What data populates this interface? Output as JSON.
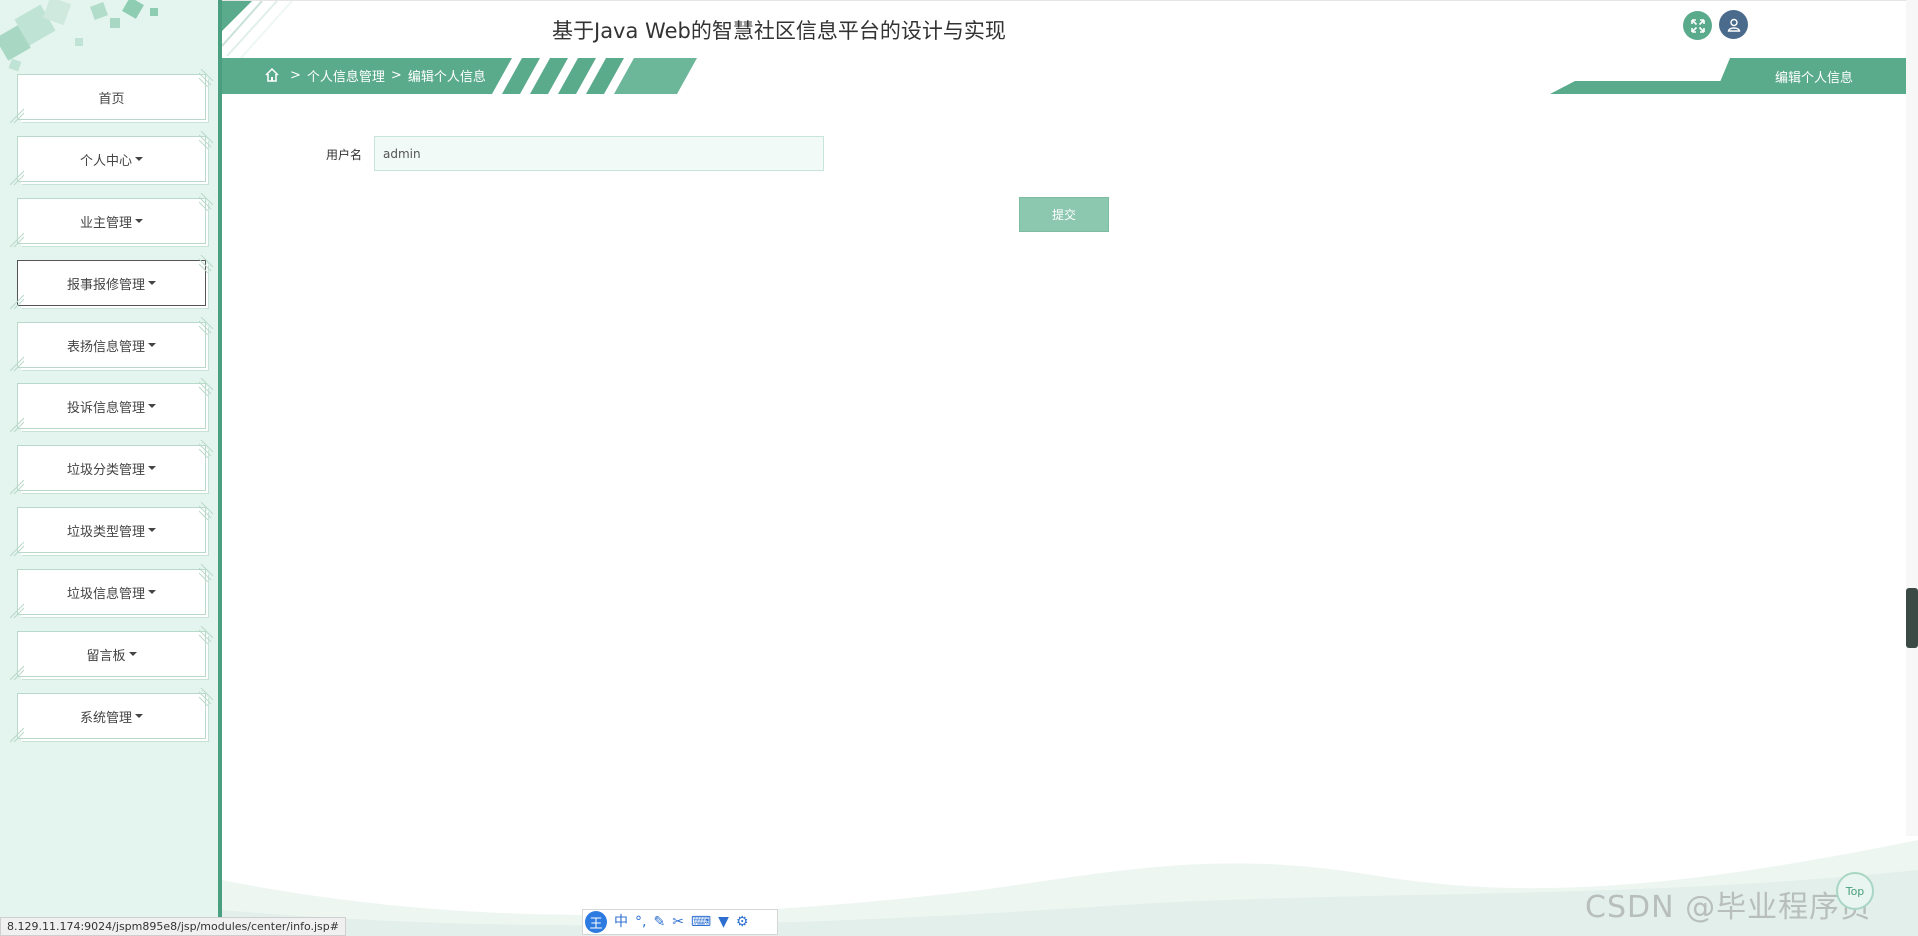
{
  "app": {
    "title": "基于Java Web的智慧社区信息平台的设计与实现"
  },
  "sidebar": {
    "items": [
      {
        "label": "首页",
        "caret": false
      },
      {
        "label": "个人中心",
        "caret": true
      },
      {
        "label": "业主管理",
        "caret": true
      },
      {
        "label": "报事报修管理",
        "caret": true
      },
      {
        "label": "表扬信息管理",
        "caret": true
      },
      {
        "label": "投诉信息管理",
        "caret": true
      },
      {
        "label": "垃圾分类管理",
        "caret": true
      },
      {
        "label": "垃圾类型管理",
        "caret": true
      },
      {
        "label": "垃圾信息管理",
        "caret": true
      },
      {
        "label": "留言板",
        "caret": true
      },
      {
        "label": "系统管理",
        "caret": true
      }
    ]
  },
  "header": {
    "fullscreen_icon": "expand-icon",
    "user_icon": "user-icon"
  },
  "breadcrumb": {
    "home_icon": "home-icon",
    "separator": ">",
    "level1": "个人信息管理",
    "level2": "编辑个人信息"
  },
  "page_tag": "编辑个人信息",
  "form": {
    "username_label": "用户名",
    "username_value": "admin",
    "submit_label": "提交"
  },
  "footer": {
    "status_url": "8.129.11.174:9024/jspm895e8/jsp/modules/center/info.jsp#",
    "top_button": "Top",
    "watermark": "CSDN @毕业程序员"
  },
  "colors": {
    "accent": "#4a9f80",
    "sidebar_bg": "#e4f4ee",
    "submit_bg": "#8cc8b0",
    "user_btn": "#4a6b8c"
  }
}
